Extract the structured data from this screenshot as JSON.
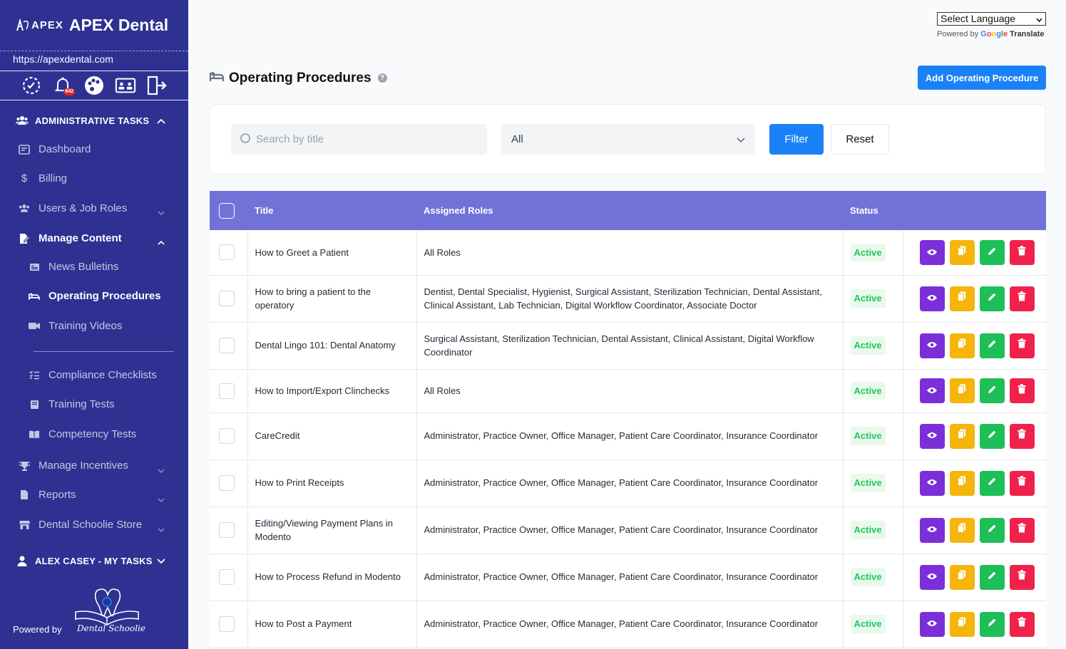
{
  "brand": {
    "logo_text": "APEX",
    "name": "APEX Dental",
    "url": "https://apexdental.com"
  },
  "iconbar": {
    "notification_count": "642"
  },
  "sidebar": {
    "section_admin": "ADMINISTRATIVE TASKS",
    "items": {
      "dashboard": "Dashboard",
      "billing": "Billing",
      "users": "Users & Job Roles",
      "manage_content": "Manage Content",
      "news": "News Bulletins",
      "operating": "Operating Procedures",
      "training_videos": "Training Videos",
      "compliance": "Compliance Checklists",
      "training_tests": "Training Tests",
      "competency": "Competency Tests",
      "incentives": "Manage Incentives",
      "reports": "Reports",
      "store": "Dental Schoolie Store"
    },
    "section_user": "ALEX CASEY - MY TASKS",
    "powered_by": "Powered by",
    "ds_brand": "Dental Schoolie"
  },
  "translate": {
    "select_label": "Select Language",
    "powered_by": "Powered by",
    "translate_word": "Translate"
  },
  "page": {
    "title": "Operating Procedures",
    "add_button": "Add Operating Procedure"
  },
  "filters": {
    "search_placeholder": "Search by title",
    "select_value": "All",
    "filter_label": "Filter",
    "reset_label": "Reset"
  },
  "table": {
    "columns": {
      "title": "Title",
      "roles": "Assigned Roles",
      "status": "Status"
    },
    "rows": [
      {
        "title": "How to Greet a Patient",
        "roles": "All Roles",
        "status": "Active"
      },
      {
        "title": "How to bring a patient to the operatory",
        "roles": "Dentist, Dental Specialist, Hygienist, Surgical Assistant, Sterilization Technician, Dental Assistant, Clinical Assistant, Lab Technician, Digital Workflow Coordinator, Associate Doctor",
        "status": "Active"
      },
      {
        "title": "Dental Lingo 101: Dental Anatomy",
        "roles": "Surgical Assistant, Sterilization Technician, Dental Assistant, Clinical Assistant, Digital Workflow Coordinator",
        "status": "Active"
      },
      {
        "title": "How to Import/Export Clinchecks",
        "roles": "All Roles",
        "status": "Active"
      },
      {
        "title": "CareCredit",
        "roles": "Administrator, Practice Owner, Office Manager, Patient Care Coordinator, Insurance Coordinator",
        "status": "Active"
      },
      {
        "title": "How to Print Receipts",
        "roles": "Administrator, Practice Owner, Office Manager, Patient Care Coordinator, Insurance Coordinator",
        "status": "Active"
      },
      {
        "title": "Editing/Viewing Payment Plans in Modento",
        "roles": "Administrator, Practice Owner, Office Manager, Patient Care Coordinator, Insurance Coordinator",
        "status": "Active"
      },
      {
        "title": "How to Process Refund in Modento",
        "roles": "Administrator, Practice Owner, Office Manager, Patient Care Coordinator, Insurance Coordinator",
        "status": "Active"
      },
      {
        "title": "How to Post a Payment",
        "roles": "Administrator, Practice Owner, Office Manager, Patient Care Coordinator, Insurance Coordinator",
        "status": "Active"
      }
    ]
  },
  "colors": {
    "sidebar_bg": "#2e3192",
    "table_header": "#7172d8",
    "primary_button": "#1a82f6",
    "status_active": "#22c55e",
    "view": "#7b2fd9",
    "copy": "#f5b50a",
    "edit": "#1dbf56",
    "delete": "#f0224c"
  }
}
